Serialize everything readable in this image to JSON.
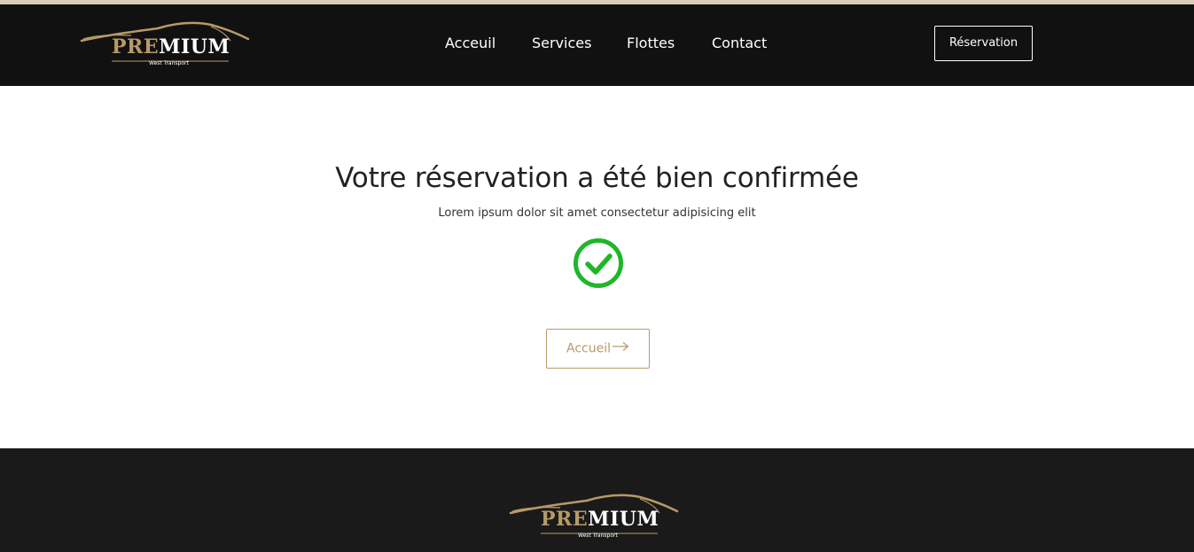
{
  "colors": {
    "accent_gold": "#b79a67",
    "header_bg": "#111111",
    "footer_bg": "#1a1a1a",
    "success_green": "#1fb62b"
  },
  "header": {
    "logo": {
      "word_gold": "PRE",
      "word_white": "MIUM",
      "subtitle": "West Transport"
    },
    "nav": [
      "Acceuil",
      "Services",
      "Flottes",
      "Contact"
    ],
    "reservation_label": "Réservation"
  },
  "main": {
    "title": "Votre réservation a été bien confirmée",
    "subtitle": "Lorem ipsum dolor sit amet consectetur adipisicing elit",
    "status_icon": "check-circle-icon",
    "home_button_label": "Accueil",
    "home_button_icon": "arrow-right-icon"
  },
  "footer": {
    "logo": {
      "word_gold": "PRE",
      "word_white": "MIUM",
      "subtitle": "West Transport"
    }
  }
}
